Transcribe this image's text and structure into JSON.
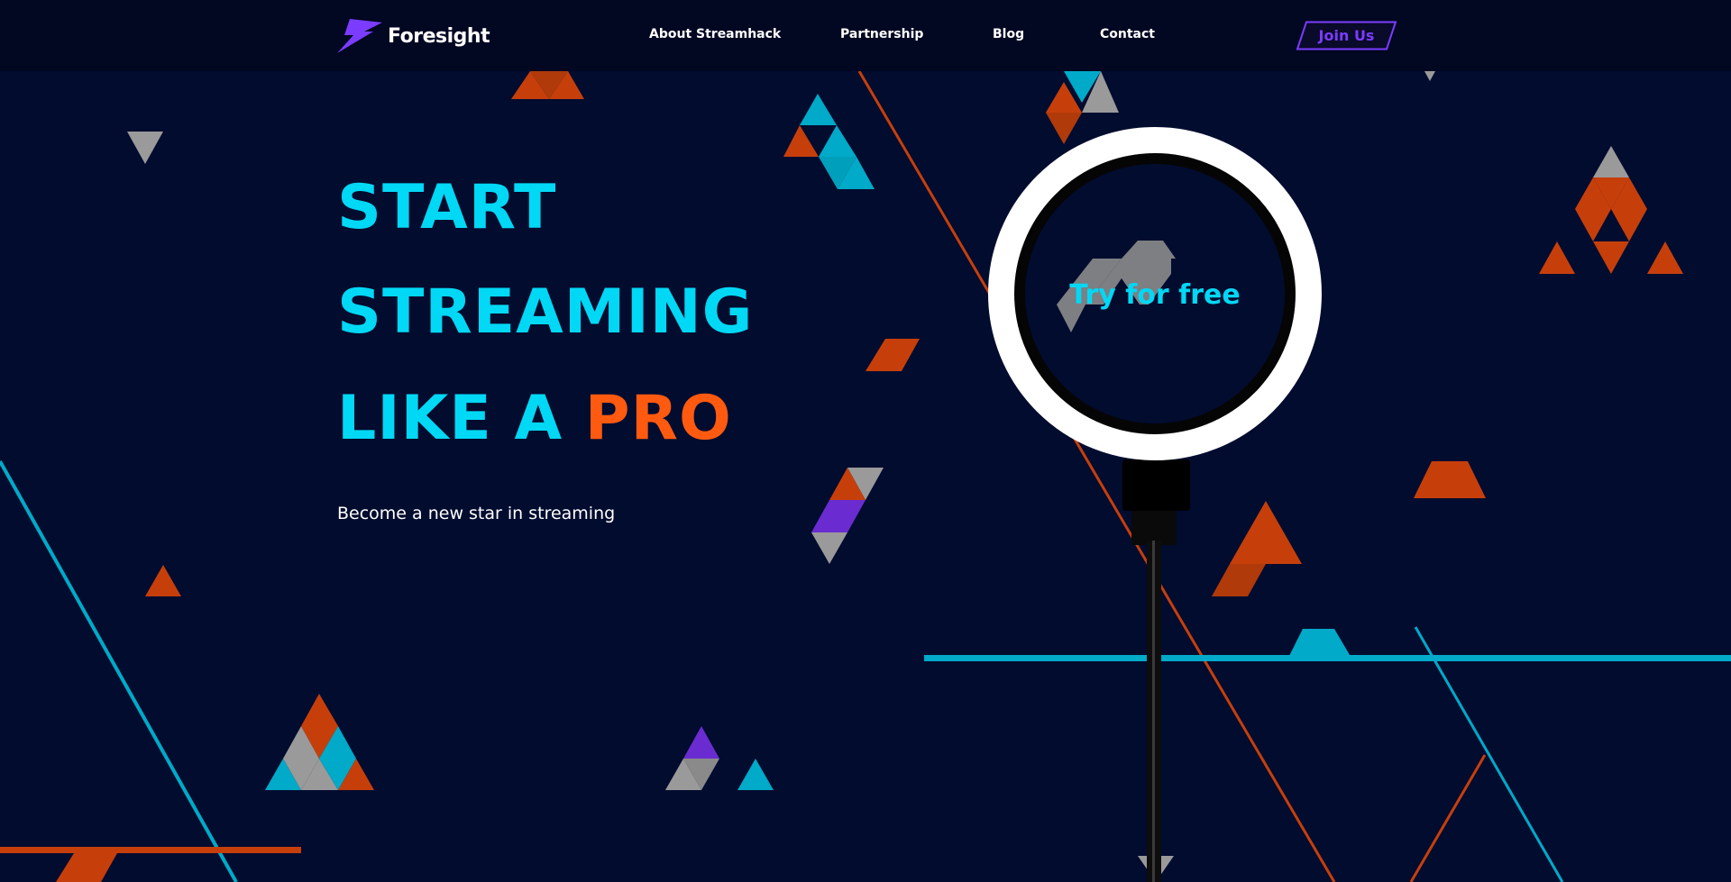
{
  "brand": {
    "name": "Foresight",
    "logo_icon": "lightning-bolt-icon",
    "accent": "#7b3cff"
  },
  "nav": {
    "items": [
      {
        "label": "About Streamhack"
      },
      {
        "label": "Partnership"
      },
      {
        "label": "Blog"
      },
      {
        "label": "Contact"
      }
    ],
    "cta_label": "Join Us"
  },
  "hero": {
    "line1": "START",
    "line2": "STREAMING",
    "line3_prefix": "LIKE A ",
    "line3_accent": "PRO",
    "subtitle": "Become a new star in streaming",
    "cta_label": "Try for free"
  },
  "colors": {
    "background": "#020c2f",
    "navbar": "#020722",
    "headline": "#00d8f5",
    "accent_orange": "#ff5a10",
    "triangle_orange": "#c63f0b",
    "triangle_cyan": "#00aac8",
    "triangle_gray": "#9a9a9a",
    "triangle_purple": "#6a2cd0"
  }
}
